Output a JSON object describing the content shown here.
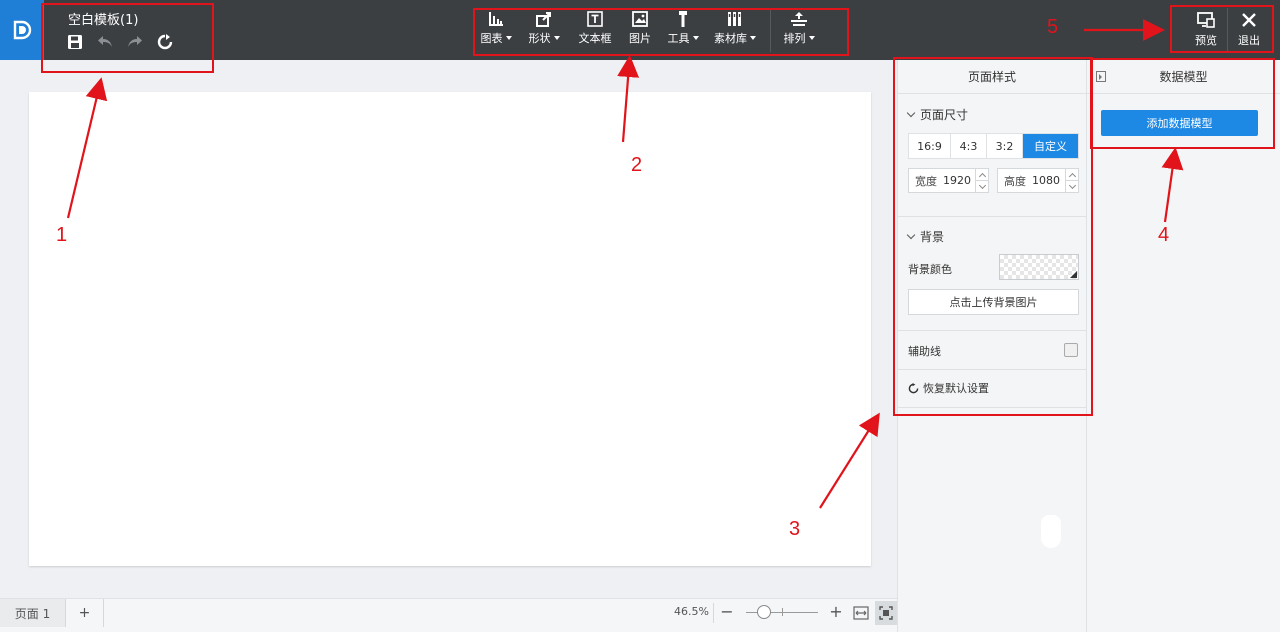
{
  "header": {
    "doc_title": "空白模板(1)",
    "toolbar": [
      {
        "key": "chart",
        "label": "图表",
        "dropdown": true,
        "icon": "bar-chart-icon"
      },
      {
        "key": "shape",
        "label": "形状",
        "dropdown": true,
        "icon": "shape-icon"
      },
      {
        "key": "textbox",
        "label": "文本框",
        "dropdown": false,
        "icon": "textbox-icon"
      },
      {
        "key": "image",
        "label": "图片",
        "dropdown": false,
        "icon": "image-icon"
      },
      {
        "key": "tools",
        "label": "工具",
        "dropdown": true,
        "icon": "hammer-icon"
      },
      {
        "key": "assets",
        "label": "素材库",
        "dropdown": true,
        "icon": "library-icon"
      },
      {
        "key": "arrange",
        "label": "排列",
        "dropdown": true,
        "icon": "arrange-icon"
      }
    ],
    "preview_label": "预览",
    "exit_label": "退出"
  },
  "annotations": [
    "1",
    "2",
    "3",
    "4",
    "5"
  ],
  "bottom": {
    "page_tab": "页面 1",
    "add_page": "+",
    "zoom": "46.5%",
    "zoom_minus": "−",
    "zoom_plus": "+",
    "zoom_level": 0.3
  },
  "page_style": {
    "title": "页面样式",
    "size_section": "页面尺寸",
    "ratios": [
      "16:9",
      "4:3",
      "3:2",
      "自定义"
    ],
    "active_ratio": "自定义",
    "width_label": "宽度",
    "width_value": "1920",
    "height_label": "高度",
    "height_value": "1080",
    "bg_section": "背景",
    "bg_color_label": "背景颜色",
    "upload_bg": "点击上传背景图片",
    "guides_label": "辅助线",
    "guides_checked": false,
    "reset_label": "恢复默认设置"
  },
  "data_model": {
    "title": "数据模型",
    "add_button": "添加数据模型"
  },
  "colors": {
    "topbar": "#3b3f42",
    "accent": "#1e88e5",
    "annotation": "#e0141a"
  }
}
